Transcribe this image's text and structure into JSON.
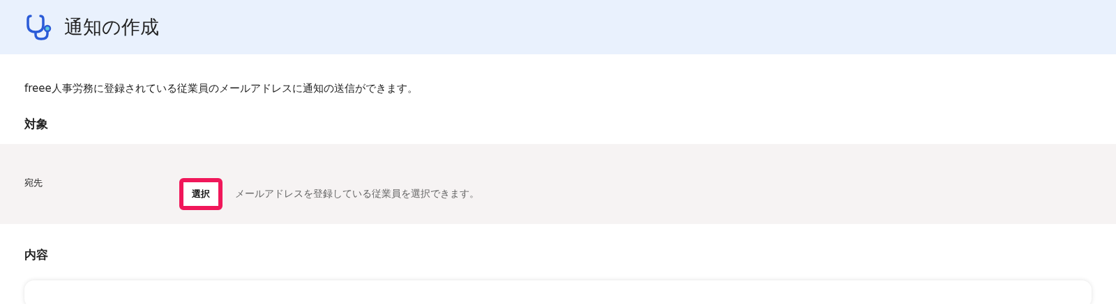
{
  "header": {
    "title": "通知の作成"
  },
  "description": "freee人事労務に登録されている従業員のメールアドレスに通知の送信ができます。",
  "sections": [
    {
      "heading": "対象"
    },
    {
      "heading": "内容"
    }
  ],
  "recipient": {
    "label": "宛先",
    "button": {
      "label": "選択",
      "highlighted": true
    },
    "hint": "メールアドレスを登録している従業員を選択できます。"
  }
}
